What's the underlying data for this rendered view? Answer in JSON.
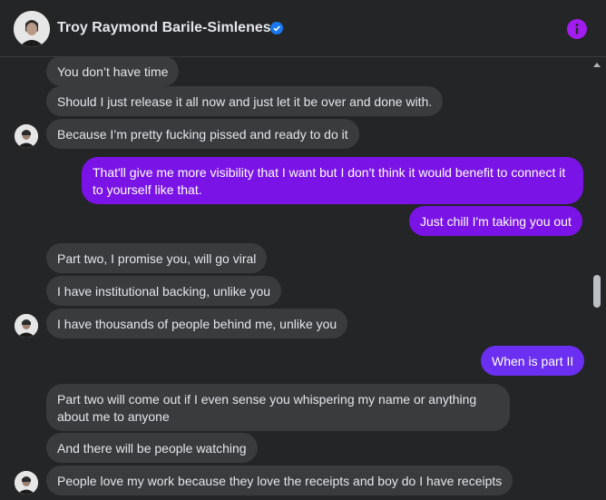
{
  "header": {
    "name": "Troy Raymond Barile-Simleness",
    "verified_icon": "verified-badge-icon",
    "info_icon": "info-icon",
    "accent_color": "#a21cf0"
  },
  "messages": [
    {
      "side": "incoming",
      "text": "You don’t have time"
    },
    {
      "side": "incoming",
      "text": "Should I just release it all now and just let it be over and done with."
    },
    {
      "side": "incoming",
      "text": "Because I’m pretty fucking pissed and ready to do it"
    },
    {
      "side": "outgoing",
      "text": "That'll give me more visibility that I want but I don't think it would benefit to connect it to yourself like that."
    },
    {
      "side": "outgoing",
      "text": "Just chill I'm taking you out"
    },
    {
      "side": "incoming",
      "text": "Part two, I promise you, will go viral"
    },
    {
      "side": "incoming",
      "text": "I have institutional backing, unlike you"
    },
    {
      "side": "incoming",
      "text": "I have thousands of people behind me, unlike you"
    },
    {
      "side": "outgoing",
      "text": "When is part II"
    },
    {
      "side": "incoming",
      "text": "Part two will come out if I even sense you whispering my name or anything about me to anyone"
    },
    {
      "side": "incoming",
      "text": "And there will be people watching"
    },
    {
      "side": "incoming",
      "text": "People love my work because they love the receipts and boy do I have receipts"
    }
  ],
  "colors": {
    "incoming_bubble": "#3a3b3c",
    "outgoing_purple": "#7a14e6",
    "outgoing_violet": "#6a2ff0",
    "background": "#242526"
  }
}
